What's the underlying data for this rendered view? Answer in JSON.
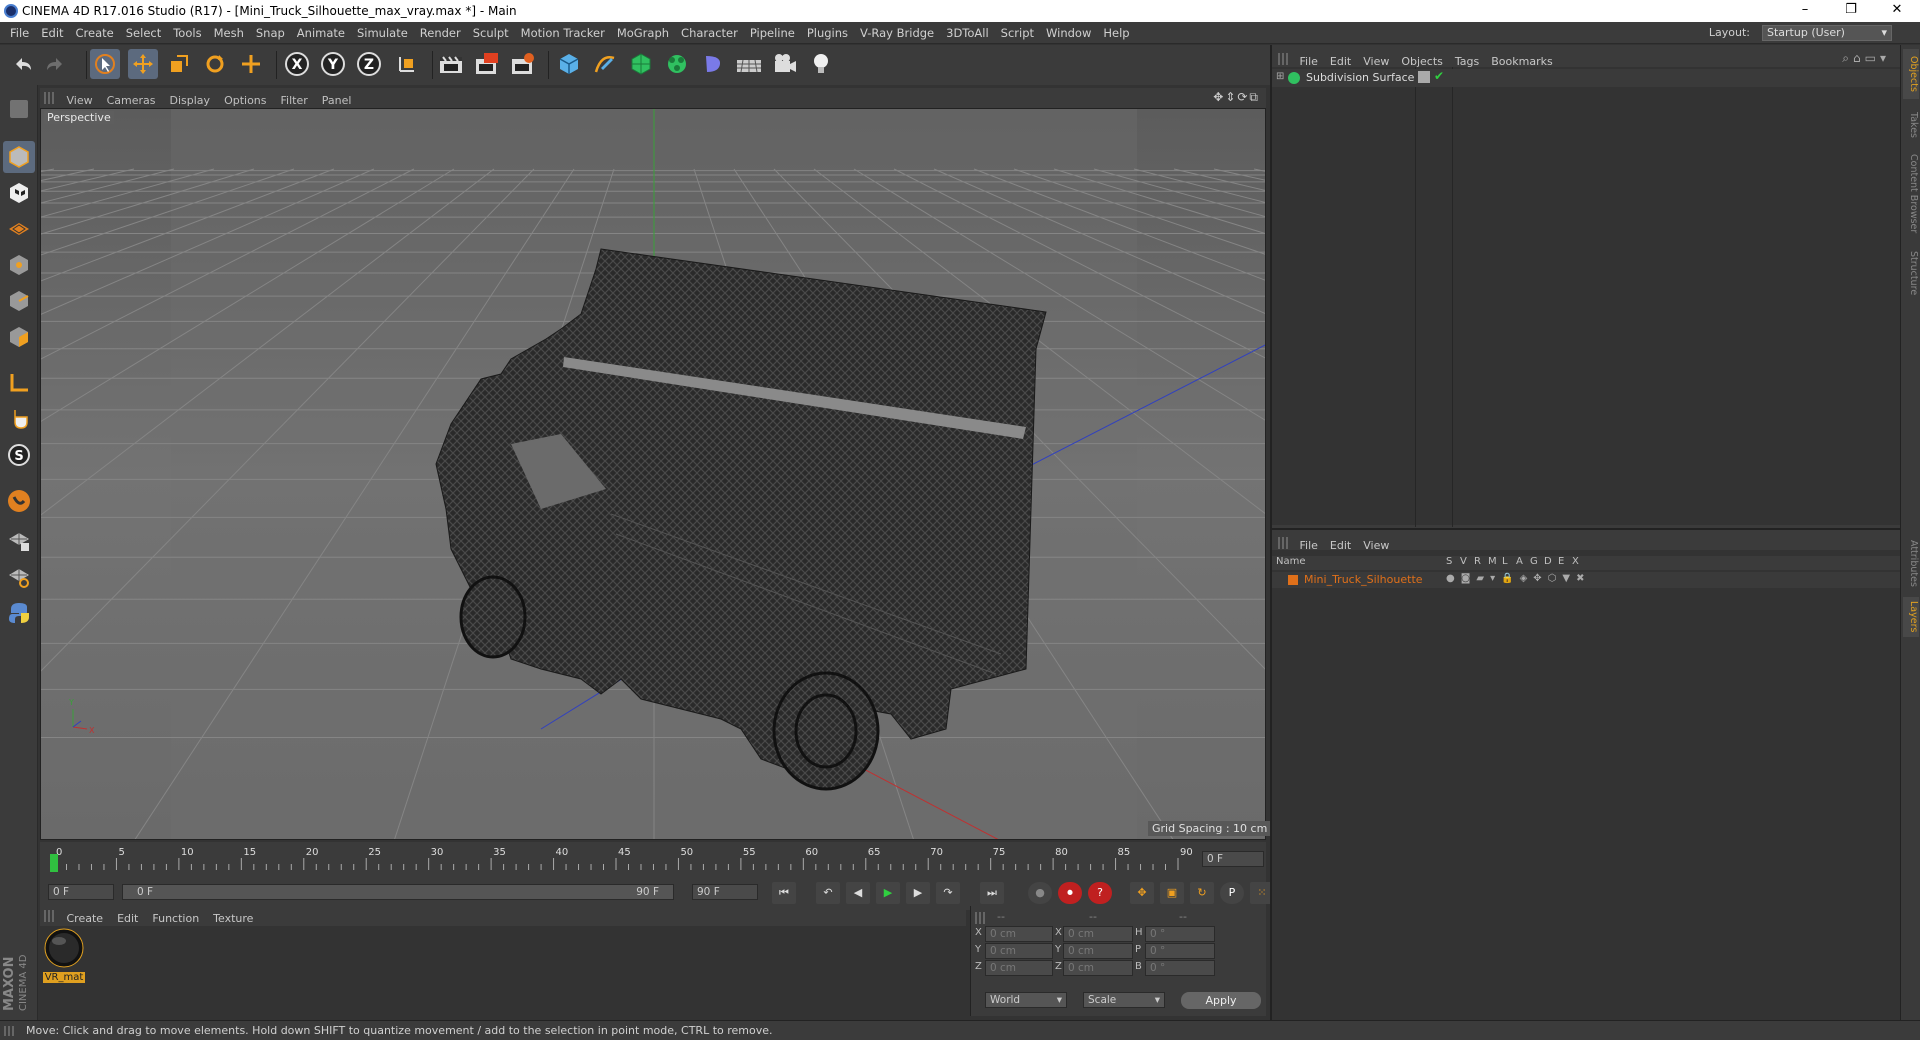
{
  "window": {
    "title": "CINEMA 4D R17.016 Studio (R17) - [Mini_Truck_Silhouette_max_vray.max *] - Main",
    "minimize": "–",
    "restore": "❐",
    "close": "✕"
  },
  "menubar": {
    "items": [
      "File",
      "Edit",
      "Create",
      "Select",
      "Tools",
      "Mesh",
      "Snap",
      "Animate",
      "Simulate",
      "Render",
      "Sculpt",
      "Motion Tracker",
      "MoGraph",
      "Character",
      "Pipeline",
      "Plugins",
      "V-Ray Bridge",
      "3DToAll",
      "Script",
      "Window",
      "Help"
    ],
    "layout_label": "Layout:",
    "layout_value": "Startup (User)"
  },
  "viewport": {
    "menu": [
      "View",
      "Cameras",
      "Display",
      "Options",
      "Filter",
      "Panel"
    ],
    "label": "Perspective",
    "grid_spacing": "Grid Spacing : 10 cm"
  },
  "timeline": {
    "ticks": [
      "0",
      "5",
      "10",
      "15",
      "20",
      "25",
      "30",
      "35",
      "40",
      "45",
      "50",
      "55",
      "60",
      "65",
      "70",
      "75",
      "80",
      "85",
      "90"
    ],
    "current_frame": "0 F",
    "start_field": "0 F",
    "range_start": "0 F",
    "range_end": "90 F",
    "end_field": "90 F"
  },
  "materials": {
    "menu": [
      "Create",
      "Edit",
      "Function",
      "Texture"
    ],
    "items": [
      {
        "name": "VR_mat"
      }
    ]
  },
  "coordinates": {
    "headers": [
      "--",
      "--",
      "--"
    ],
    "rows": [
      {
        "a": "X",
        "av": "0 cm",
        "b": "X",
        "bv": "0 cm",
        "c": "H",
        "cv": "0 °"
      },
      {
        "a": "Y",
        "av": "0 cm",
        "b": "Y",
        "bv": "0 cm",
        "c": "P",
        "cv": "0 °"
      },
      {
        "a": "Z",
        "av": "0 cm",
        "b": "Z",
        "bv": "0 cm",
        "c": "B",
        "cv": "0 °"
      }
    ],
    "world": "World",
    "scale": "Scale",
    "apply": "Apply"
  },
  "objects": {
    "menu": [
      "File",
      "Edit",
      "View",
      "Objects",
      "Tags",
      "Bookmarks"
    ],
    "items": [
      {
        "name": "Subdivision Surface"
      }
    ]
  },
  "layers": {
    "menu": [
      "File",
      "Edit",
      "View"
    ],
    "header_name": "Name",
    "columns": [
      "S",
      "V",
      "R",
      "M",
      "L",
      "A",
      "G",
      "D",
      "E",
      "X"
    ],
    "items": [
      {
        "name": "Mini_Truck_Silhouette",
        "color": "#e0701a"
      }
    ]
  },
  "side_tabs": [
    "Objects",
    "Takes",
    "Content Browser",
    "Structure",
    "Attributes",
    "Layers"
  ],
  "status": "Move: Click and drag to move elements. Hold down SHIFT to quantize movement / add to the selection in point mode, CTRL to remove.",
  "branding": {
    "maxon": "MAXON",
    "c4d": "CINEMA 4D"
  },
  "colors": {
    "accent": "#e0701a",
    "selected_tool": "#5c6a7e",
    "viewport_bg": "#6b6b6b"
  }
}
